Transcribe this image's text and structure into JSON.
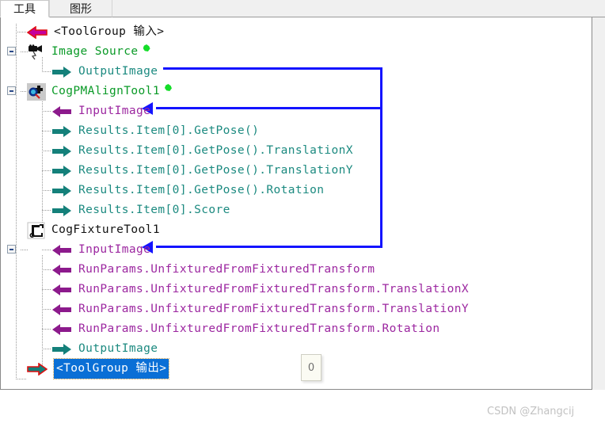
{
  "window": {
    "tabs": [
      {
        "label": "工具",
        "active": true
      },
      {
        "label": "图形",
        "active": false
      }
    ]
  },
  "tree": {
    "rows": [
      {
        "text": "<ToolGroup 输入>",
        "kind": "group-input",
        "arrow": "arrow-left-magenta",
        "indent": 1,
        "color": "black"
      },
      {
        "text": "Image Source",
        "kind": "tool",
        "icon": "camera-icon",
        "indent": 0,
        "color": "green",
        "status_dot": true,
        "expander": "minus"
      },
      {
        "text": "OutputImage",
        "kind": "terminal-output",
        "arrow": "arrow-right-teal",
        "indent": 2,
        "color": "teal"
      },
      {
        "text": "CogPMAlignTool1",
        "kind": "tool",
        "icon": "pmalign-icon",
        "indent": 0,
        "color": "green",
        "status_dot": true,
        "expander": "minus"
      },
      {
        "text": "InputImage",
        "kind": "terminal-input",
        "arrow": "arrow-left-purple",
        "indent": 2,
        "color": "purple"
      },
      {
        "text": "Results.Item[0].GetPose()",
        "kind": "terminal-output",
        "arrow": "arrow-right-teal",
        "indent": 2,
        "color": "teal"
      },
      {
        "text": "Results.Item[0].GetPose().TranslationX",
        "kind": "terminal-output",
        "arrow": "arrow-right-teal",
        "indent": 2,
        "color": "teal"
      },
      {
        "text": "Results.Item[0].GetPose().TranslationY",
        "kind": "terminal-output",
        "arrow": "arrow-right-teal",
        "indent": 2,
        "color": "teal"
      },
      {
        "text": "Results.Item[0].GetPose().Rotation",
        "kind": "terminal-output",
        "arrow": "arrow-right-teal",
        "indent": 2,
        "color": "teal"
      },
      {
        "text": "Results.Item[0].Score",
        "kind": "terminal-output",
        "arrow": "arrow-right-teal",
        "indent": 2,
        "color": "teal"
      },
      {
        "text": "CogFixtureTool1",
        "kind": "tool",
        "icon": "fixture-icon",
        "indent": 0,
        "color": "black",
        "status_dot": false,
        "expander": "minus"
      },
      {
        "text": "InputImage",
        "kind": "terminal-input",
        "arrow": "arrow-left-purple",
        "indent": 2,
        "color": "purple"
      },
      {
        "text": "RunParams.UnfixturedFromFixturedTransform",
        "kind": "terminal-input",
        "arrow": "arrow-left-purple",
        "indent": 2,
        "color": "purple"
      },
      {
        "text": "RunParams.UnfixturedFromFixturedTransform.TranslationX",
        "kind": "terminal-input",
        "arrow": "arrow-left-purple",
        "indent": 2,
        "color": "purple"
      },
      {
        "text": "RunParams.UnfixturedFromFixturedTransform.TranslationY",
        "kind": "terminal-input",
        "arrow": "arrow-left-purple",
        "indent": 2,
        "color": "purple"
      },
      {
        "text": "RunParams.UnfixturedFromFixturedTransform.Rotation",
        "kind": "terminal-input",
        "arrow": "arrow-left-purple",
        "indent": 2,
        "color": "purple"
      },
      {
        "text": "OutputImage",
        "kind": "terminal-output",
        "arrow": "arrow-right-teal",
        "indent": 2,
        "color": "teal"
      },
      {
        "text": "<ToolGroup 输出>",
        "kind": "group-output",
        "arrow": "arrow-right-teal-red",
        "indent": 1,
        "color": "selected",
        "selected": true
      }
    ]
  },
  "drag_box": {
    "value": "0"
  },
  "watermark": {
    "text": "CSDN @Zhangcij"
  },
  "colors": {
    "tool_green": "#0a9a27",
    "output_teal": "#1c8a80",
    "input_purple": "#9c27a0",
    "wire_blue": "#1414ff",
    "selection_blue": "#0a6fd6",
    "status_dot_green": "#15dd2a"
  }
}
